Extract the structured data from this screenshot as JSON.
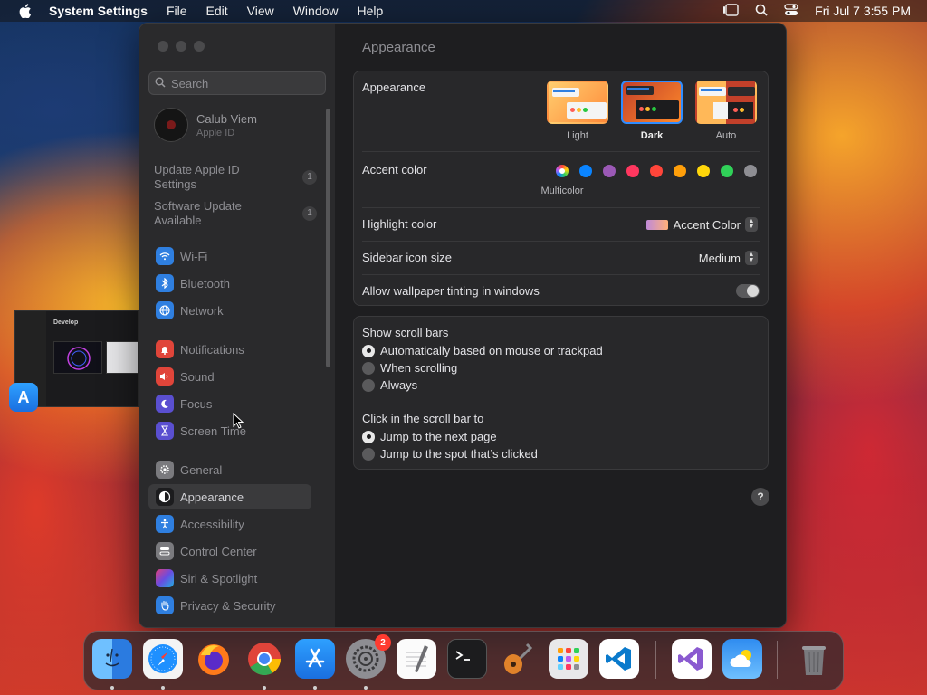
{
  "menubar": {
    "app_name": "System Settings",
    "items": [
      "File",
      "Edit",
      "View",
      "Window",
      "Help"
    ],
    "clock": "Fri Jul 7  3:55 PM"
  },
  "sidebar": {
    "search_placeholder": "Search",
    "user": {
      "name": "Calub Viem",
      "subtitle": "Apple ID"
    },
    "updates": [
      {
        "label": "Update Apple ID Settings",
        "count": "1"
      },
      {
        "label": "Software Update Available",
        "count": "1"
      }
    ],
    "items": [
      {
        "label": "Wi-Fi",
        "icon": "wifi-icon",
        "color": "#2f7fe0"
      },
      {
        "label": "Bluetooth",
        "icon": "bluetooth-icon",
        "color": "#2f7fe0"
      },
      {
        "label": "Network",
        "icon": "globe-icon",
        "color": "#2f7fe0"
      },
      {
        "label": "Notifications",
        "icon": "bell-icon",
        "color": "#e0453a"
      },
      {
        "label": "Sound",
        "icon": "speaker-icon",
        "color": "#e0453a"
      },
      {
        "label": "Focus",
        "icon": "moon-icon",
        "color": "#5a4fd0"
      },
      {
        "label": "Screen Time",
        "icon": "hourglass-icon",
        "color": "#5a4fd0"
      },
      {
        "label": "General",
        "icon": "gear-icon",
        "color": "#7a7a7e"
      },
      {
        "label": "Appearance",
        "icon": "appearance-icon",
        "color": "#1c1c1e"
      },
      {
        "label": "Accessibility",
        "icon": "accessibility-icon",
        "color": "#2f7fe0"
      },
      {
        "label": "Control Center",
        "icon": "control-center-icon",
        "color": "#7a7a7e"
      },
      {
        "label": "Siri & Spotlight",
        "icon": "siri-icon",
        "color": "#b04ad0"
      },
      {
        "label": "Privacy & Security",
        "icon": "hand-icon",
        "color": "#2f7fe0"
      }
    ],
    "selected": "Appearance"
  },
  "content": {
    "title": "Appearance",
    "appearance": {
      "label": "Appearance",
      "options": [
        "Light",
        "Dark",
        "Auto"
      ],
      "selected": "Dark"
    },
    "accent": {
      "label": "Accent color",
      "selected_name": "Multicolor",
      "colors": [
        "#0a84ff",
        "#9b59b6",
        "#ff375f",
        "#ff453a",
        "#ff9f0a",
        "#ffd60a",
        "#30d158",
        "#8e8e93"
      ]
    },
    "highlight": {
      "label": "Highlight color",
      "value": "Accent Color"
    },
    "icon_size": {
      "label": "Sidebar icon size",
      "value": "Medium"
    },
    "tinting": {
      "label": "Allow wallpaper tinting in windows",
      "enabled": true
    },
    "scroll_bars": {
      "label": "Show scroll bars",
      "options": [
        "Automatically based on mouse or trackpad",
        "When scrolling",
        "Always"
      ],
      "selected": 0
    },
    "click_scroll": {
      "label": "Click in the scroll bar to",
      "options": [
        "Jump to the next page",
        "Jump to the spot that’s clicked"
      ],
      "selected": 0
    },
    "help": "?"
  },
  "preview": {
    "title": "Develop"
  },
  "dock": {
    "apps": [
      "Finder",
      "Safari",
      "Firefox",
      "Chrome",
      "App Store",
      "System Settings",
      "TextEdit",
      "Terminal",
      "GarageBand",
      "Launchpad",
      "Visual Studio Code",
      "Visual Studio",
      "Weather",
      "Trash"
    ],
    "settings_badge": "2"
  }
}
